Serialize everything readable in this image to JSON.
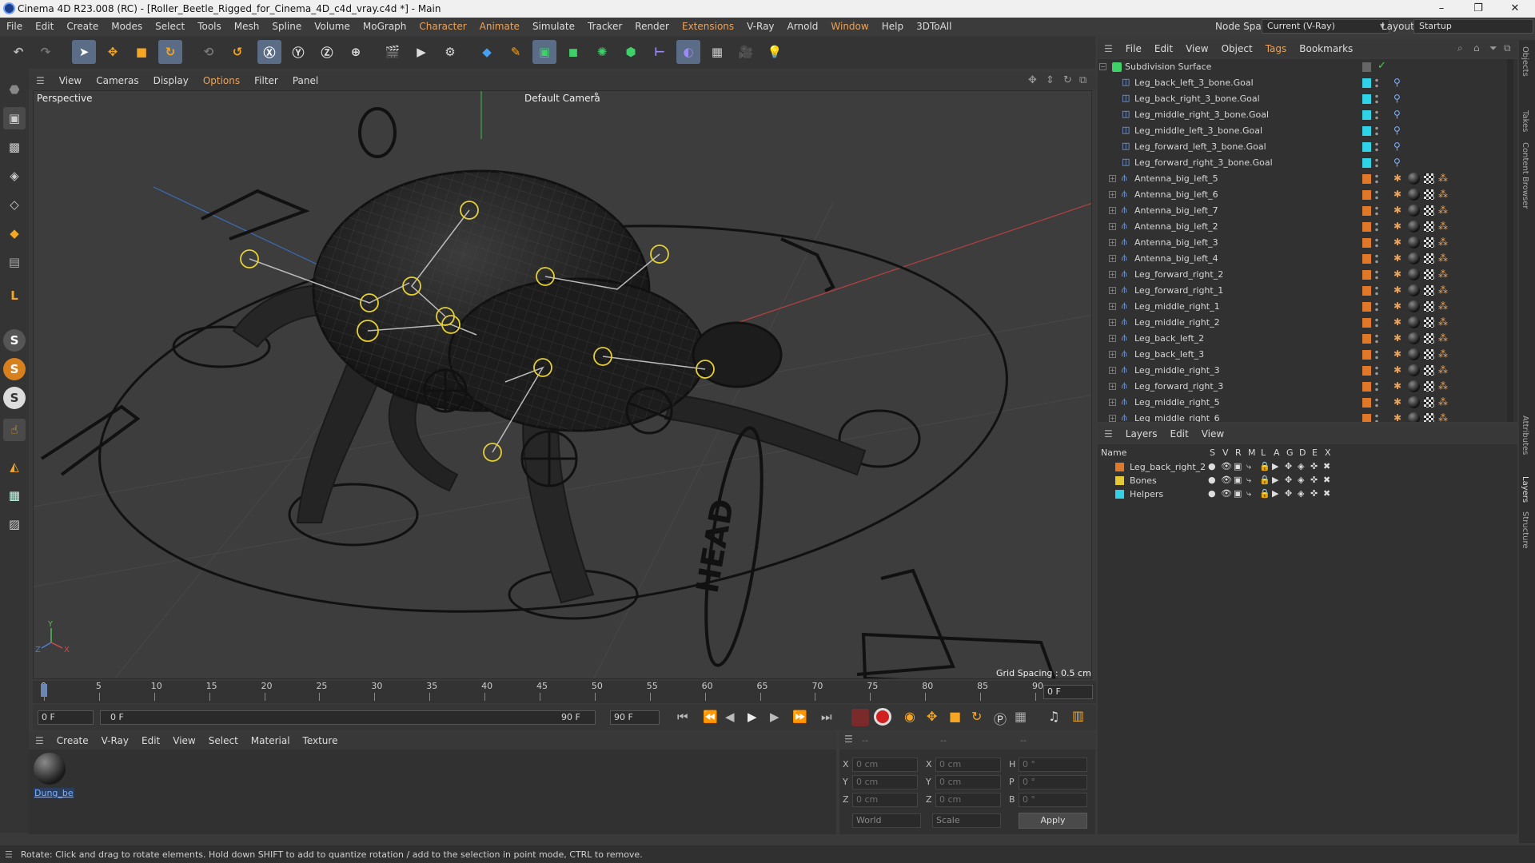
{
  "window": {
    "title": "Cinema 4D R23.008 (RC) - [Roller_Beetle_Rigged_for_Cinema_4D_c4d_vray.c4d *] - Main",
    "minimize": "–",
    "restore": "❐",
    "close": "✕"
  },
  "menubar": {
    "items": [
      "File",
      "Edit",
      "Create",
      "Modes",
      "Select",
      "Tools",
      "Mesh",
      "Spline",
      "Volume",
      "MoGraph",
      "Character",
      "Animate",
      "Simulate",
      "Tracker",
      "Render",
      "Extensions",
      "V-Ray",
      "Arnold",
      "Window",
      "Help",
      "3DToAll"
    ],
    "node_space_label": "Node Space:",
    "node_space_value": "Current (V-Ray)",
    "layout_label": "Layout:",
    "layout_value": "Startup"
  },
  "viewport": {
    "menu": [
      "View",
      "Cameras",
      "Display",
      "Options",
      "Filter",
      "Panel"
    ],
    "view_name": "Perspective",
    "camera": "Default Camera",
    "camera_icon": "·°",
    "grid_spacing": "Grid Spacing : 0.5 cm",
    "axis_y": "Y",
    "axis_z": "Z",
    "axis_x": "X",
    "head_text": "HEAD"
  },
  "timeline": {
    "ticks": [
      "0",
      "5",
      "10",
      "15",
      "20",
      "25",
      "30",
      "35",
      "40",
      "45",
      "50",
      "55",
      "60",
      "65",
      "70",
      "75",
      "80",
      "85",
      "90"
    ],
    "current_frame_field": "0 F",
    "start_field": "0 F",
    "range_start": "0 F",
    "range_end": "90 F",
    "end_field": "90 F"
  },
  "material_manager": {
    "menu": [
      "Create",
      "V-Ray",
      "Edit",
      "View",
      "Select",
      "Material",
      "Texture"
    ],
    "materials": [
      {
        "name": "Dung_be"
      }
    ]
  },
  "coordinates": {
    "header_dashes": [
      "--",
      "--",
      "--"
    ],
    "rows": [
      {
        "a": "X",
        "av": "0 cm",
        "b": "X",
        "bv": "0 cm",
        "c": "H",
        "cv": "0 °"
      },
      {
        "a": "Y",
        "av": "0 cm",
        "b": "Y",
        "bv": "0 cm",
        "c": "P",
        "cv": "0 °"
      },
      {
        "a": "Z",
        "av": "0 cm",
        "b": "Z",
        "bv": "0 cm",
        "c": "B",
        "cv": "0 °"
      }
    ],
    "mode": "World",
    "scale": "Scale",
    "apply": "Apply"
  },
  "status": {
    "text": "Rotate: Click and drag to rotate elements. Hold down SHIFT to add to quantize rotation / add to the selection in point mode, CTRL to remove."
  },
  "object_manager": {
    "menu": [
      "File",
      "Edit",
      "View",
      "Object",
      "Tags",
      "Bookmarks"
    ],
    "root": "Subdivision Surface",
    "goal_rows": [
      "Leg_back_left_3_bone.Goal",
      "Leg_back_right_3_bone.Goal",
      "Leg_middle_right_3_bone.Goal",
      "Leg_middle_left_3_bone.Goal",
      "Leg_forward_left_3_bone.Goal",
      "Leg_forward_right_3_bone.Goal"
    ],
    "bone_rows": [
      "Antenna_big_left_5",
      "Antenna_big_left_6",
      "Antenna_big_left_7",
      "Antenna_big_left_2",
      "Antenna_big_left_3",
      "Antenna_big_left_4",
      "Leg_forward_right_2",
      "Leg_forward_right_1",
      "Leg_middle_right_1",
      "Leg_middle_right_2",
      "Leg_back_left_2",
      "Leg_back_left_3",
      "Leg_middle_right_3",
      "Leg_forward_right_3",
      "Leg_middle_right_5",
      "Leg_middle_right_6"
    ],
    "colors": {
      "goal": "#32d2e6",
      "bone": "#e0782a"
    }
  },
  "layer_manager": {
    "menu": [
      "Layers",
      "Edit",
      "View"
    ],
    "columns": [
      "Name",
      "S",
      "V",
      "R",
      "M",
      "L",
      "A",
      "G",
      "D",
      "E",
      "X"
    ],
    "layers": [
      {
        "name": "Leg_back_right_2",
        "color": "#e0782a"
      },
      {
        "name": "Bones",
        "color": "#e6c832"
      },
      {
        "name": "Helpers",
        "color": "#32d2e6"
      }
    ]
  },
  "side_tabs": [
    "Objects",
    "Takes",
    "Content Browser",
    "Attributes",
    "Layers",
    "Structure"
  ]
}
